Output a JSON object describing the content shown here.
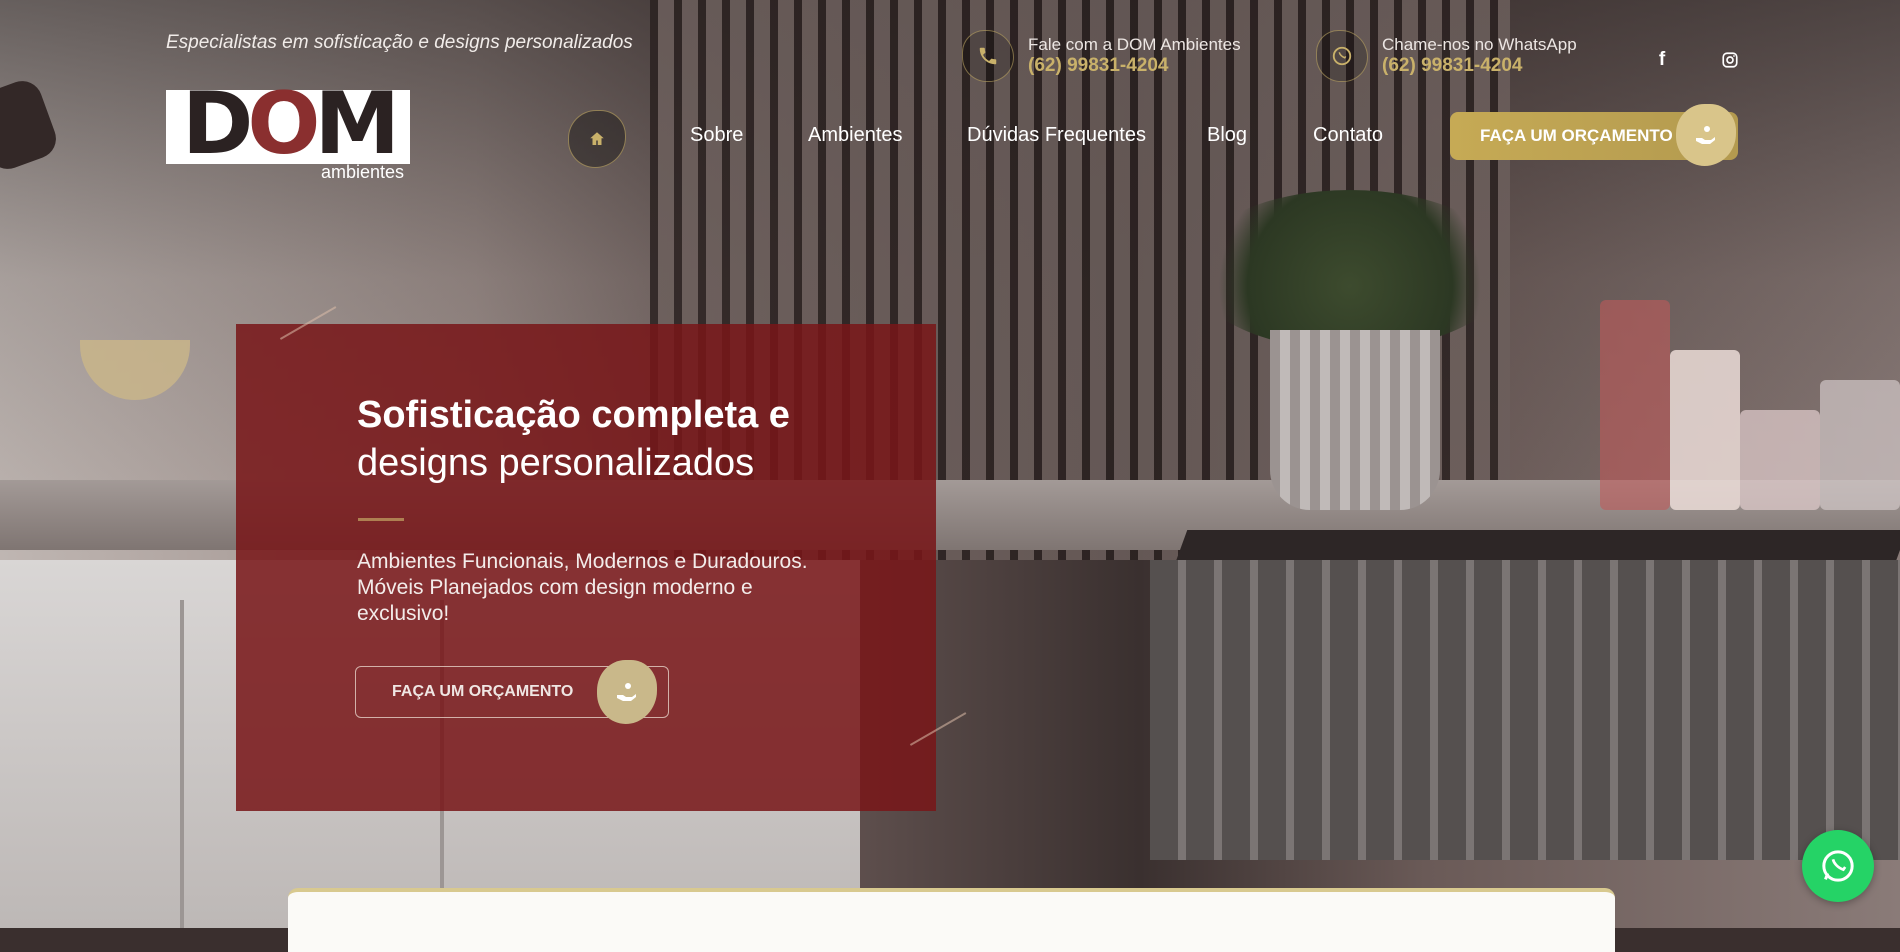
{
  "header": {
    "tagline": "Especialistas em sofisticação e designs personalizados",
    "logo": {
      "wordmark": "DOM",
      "subtitle": "ambientes"
    },
    "contact_phone": {
      "label": "Fale com a DOM Ambientes",
      "number": "(62) 99831-4204",
      "icon": "phone-icon"
    },
    "contact_whatsapp": {
      "label": "Chame-nos no WhatsApp",
      "number": "(62) 99831-4204",
      "icon": "whatsapp-icon"
    },
    "social": [
      {
        "name": "facebook",
        "glyph": "f"
      },
      {
        "name": "instagram",
        "glyph": "◎"
      }
    ]
  },
  "nav": {
    "home_icon": "home-icon",
    "links": [
      "Sobre",
      "Ambientes",
      "Dúvidas Frequentes",
      "Blog",
      "Contato"
    ],
    "cta_label": "FAÇA UM ORÇAMENTO"
  },
  "hero": {
    "headline_bold": "Sofisticação completa e",
    "headline_light": "designs personalizados",
    "description": "Ambientes Funcionais, Modernos e Duradouros. Móveis Planejados com design moderno e exclusivo!",
    "cta_label": "FAÇA UM ORÇAMENTO"
  },
  "colors": {
    "accent_gold": "#c9b16a",
    "card_red": "#781618",
    "whatsapp_green": "#25d366"
  }
}
